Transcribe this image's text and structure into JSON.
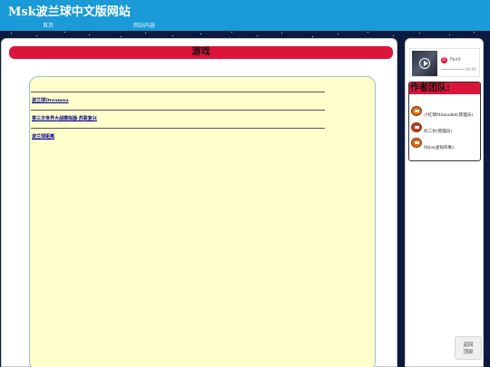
{
  "header": {
    "site_title": "Msk波兰球中文版网站",
    "nav": [
      {
        "label": "首页"
      },
      {
        "label": "网站内容"
      }
    ]
  },
  "main": {
    "section_title": "游戏",
    "games": [
      {
        "label": "波兰球Dreamua"
      },
      {
        "label": "第三次世界大战模拟器·苏联复兴"
      },
      {
        "label": "波兰球距离"
      }
    ]
  },
  "sidebar": {
    "music_player": {
      "song_name": "Faint",
      "time": "00:00",
      "logo_char": "云"
    },
    "team": {
      "title": "作者团队:",
      "members": [
        {
          "name": "小红球Minisoket(管理员)",
          "icon": "countryball-avatar-icon"
        },
        {
          "name": "托二尔(管理员)",
          "icon": "countryball-avatar-icon"
        },
        {
          "name": "Mira(虚拟形象)",
          "icon": "countryball-avatar-icon"
        }
      ]
    }
  },
  "back_to_top": {
    "line1": "返回",
    "line2": "顶部"
  },
  "colors": {
    "header_bg": "#1a9ad6",
    "section_bar": "#dc143c",
    "content_bg": "#ffffcc",
    "link": "#00008b"
  }
}
